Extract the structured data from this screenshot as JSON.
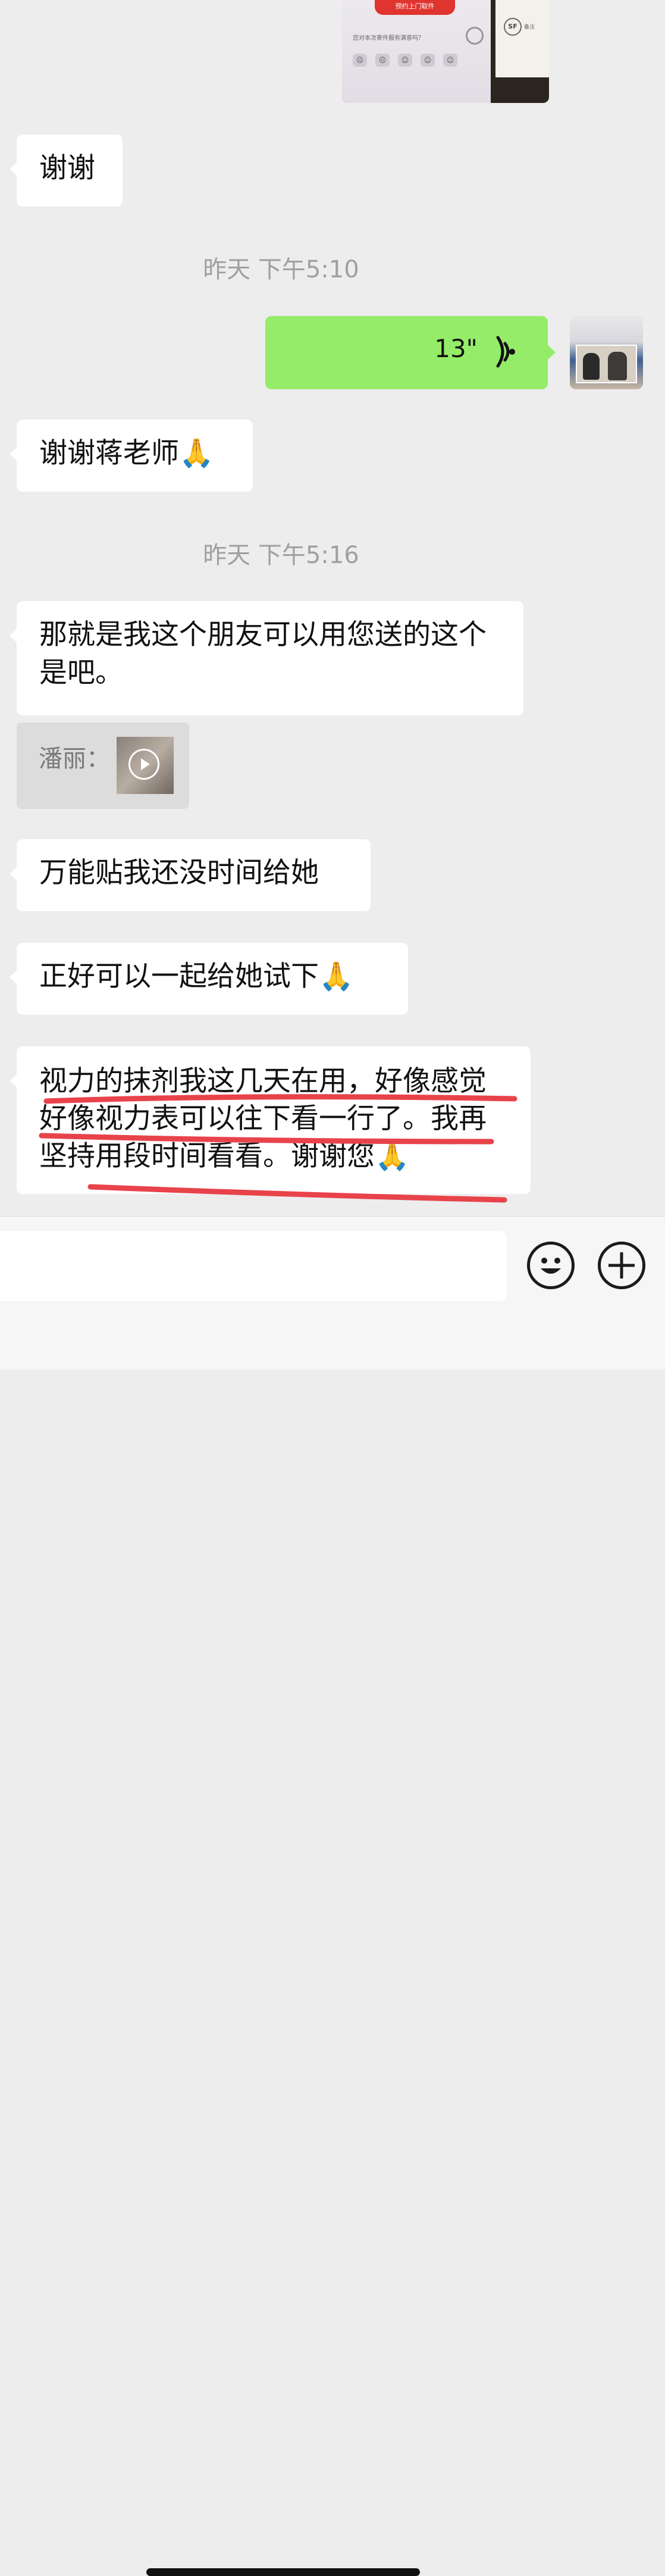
{
  "received_image": {
    "button_text": "预约上门取件",
    "rating_prompt": "您对本次寄件服务满意吗？",
    "card_logo": "SF",
    "card_text": "备注"
  },
  "messages": [
    {
      "text": "谢谢"
    },
    {
      "text": "谢谢蒋老师🙏"
    },
    {
      "text": "那就是我这个朋友可以用您送的这个是吧。"
    },
    {
      "text": "万能贴我还没时间给她"
    },
    {
      "text": "正好可以一起给她试下🙏"
    },
    {
      "text": "视力的抹剂我这几天在用，好像感觉好像视力表可以往下看一行了。我再坚持用段时间看看。谢谢您🙏"
    }
  ],
  "timestamps": [
    "昨天 下午5:10",
    "昨天 下午5:16"
  ],
  "voice_message": {
    "duration": "13\""
  },
  "quote": {
    "name": "潘丽："
  },
  "input": {
    "placeholder": ""
  },
  "colors": {
    "background": "#ededed",
    "sent_bubble": "#95ec69",
    "received_bubble": "#ffffff",
    "underline": "#e8434a"
  },
  "icons": [
    "voice-wave-icon",
    "play-icon",
    "emoji-icon",
    "plus-icon"
  ]
}
